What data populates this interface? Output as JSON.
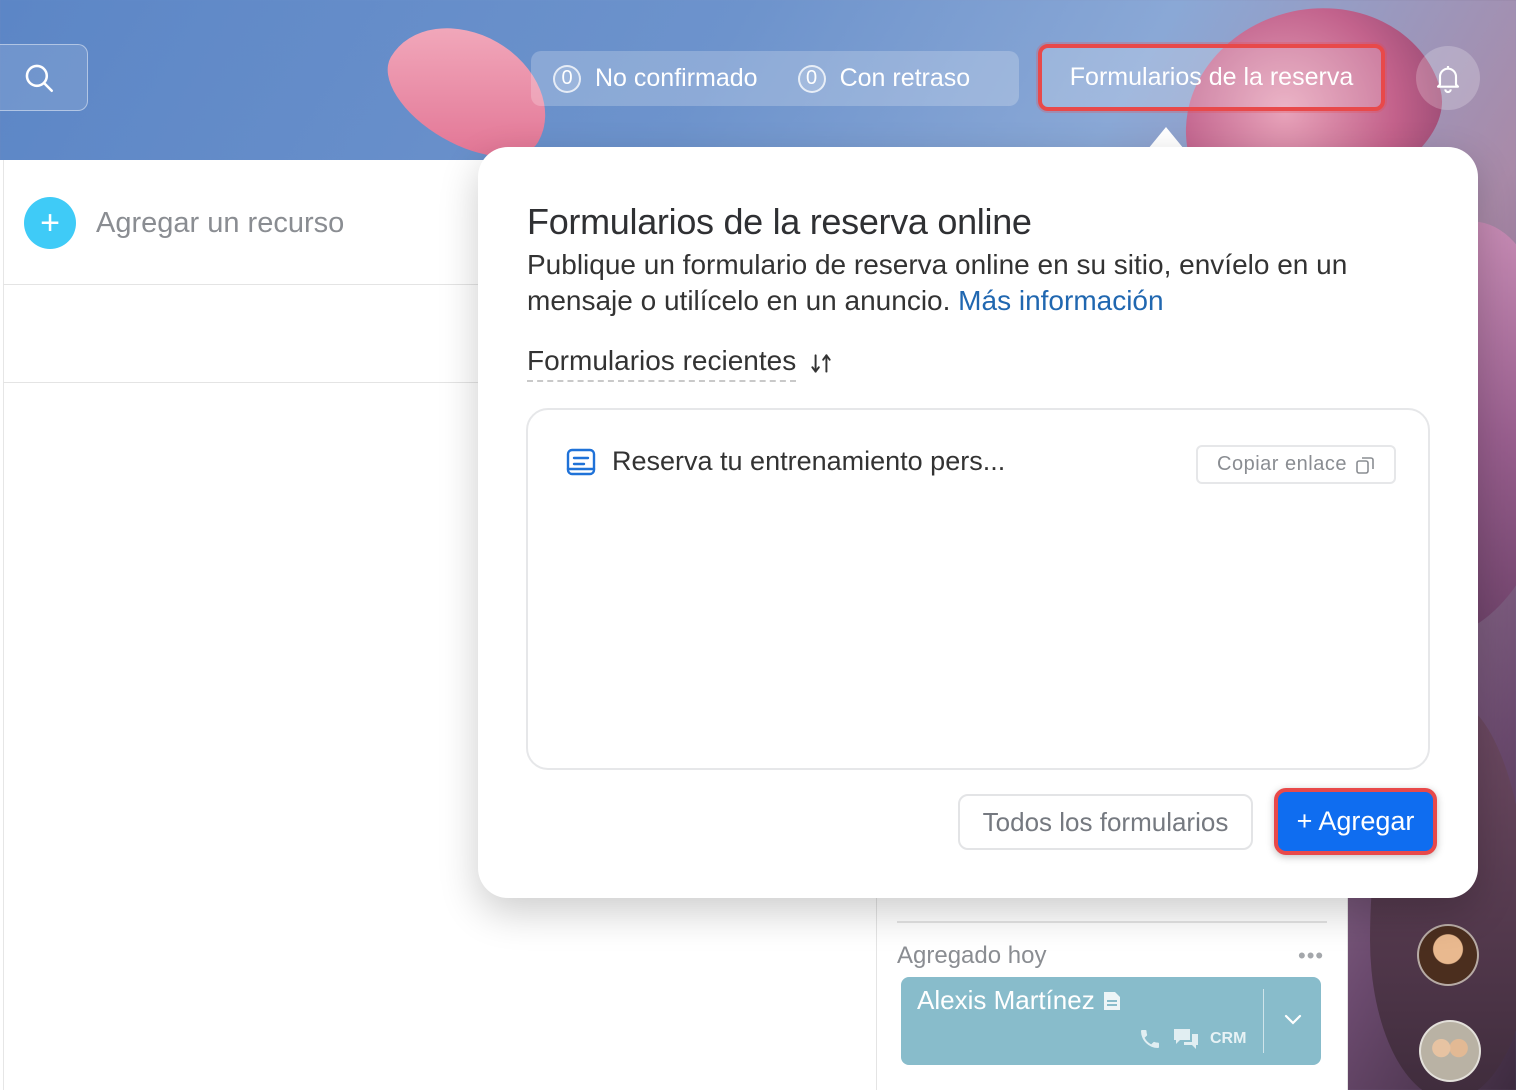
{
  "topbar": {
    "unconfirmed_count": "0",
    "unconfirmed_label": "No confirmado",
    "delayed_count": "0",
    "delayed_label": "Con retraso",
    "forms_button_label": "Formularios de la reserva"
  },
  "left_panel": {
    "add_resource_label": "Agregar un recurso"
  },
  "popover": {
    "title": "Formularios de la reserva online",
    "description": "Publique un formulario de reserva online en su sitio, envíelo en un mensaje o utilícelo en un anuncio.",
    "more_info_link": "Más información",
    "recent_label": "Formularios recientes",
    "forms": [
      {
        "name": "Reserva tu entrenamiento pers...",
        "copy_label": "Copiar enlace"
      }
    ],
    "all_forms_label": "Todos los formularios",
    "add_label": "+ Agregar"
  },
  "activity": {
    "section_label": "Agregado hoy",
    "contact_name": "Alexis Martínez",
    "crm_label": "CRM"
  },
  "colors": {
    "accent_blue": "#0f6df0",
    "highlight_red": "#e8494a",
    "add_resource_cyan": "#3fcbf7",
    "link_blue": "#2067b0",
    "contact_card": "#88bccb"
  },
  "icons": [
    "search-icon",
    "bell-icon",
    "plus-icon",
    "sort-icon",
    "form-icon",
    "copy-icon",
    "note-icon",
    "phone-icon",
    "chat-icon",
    "chevron-down-icon",
    "more-dots-icon"
  ]
}
